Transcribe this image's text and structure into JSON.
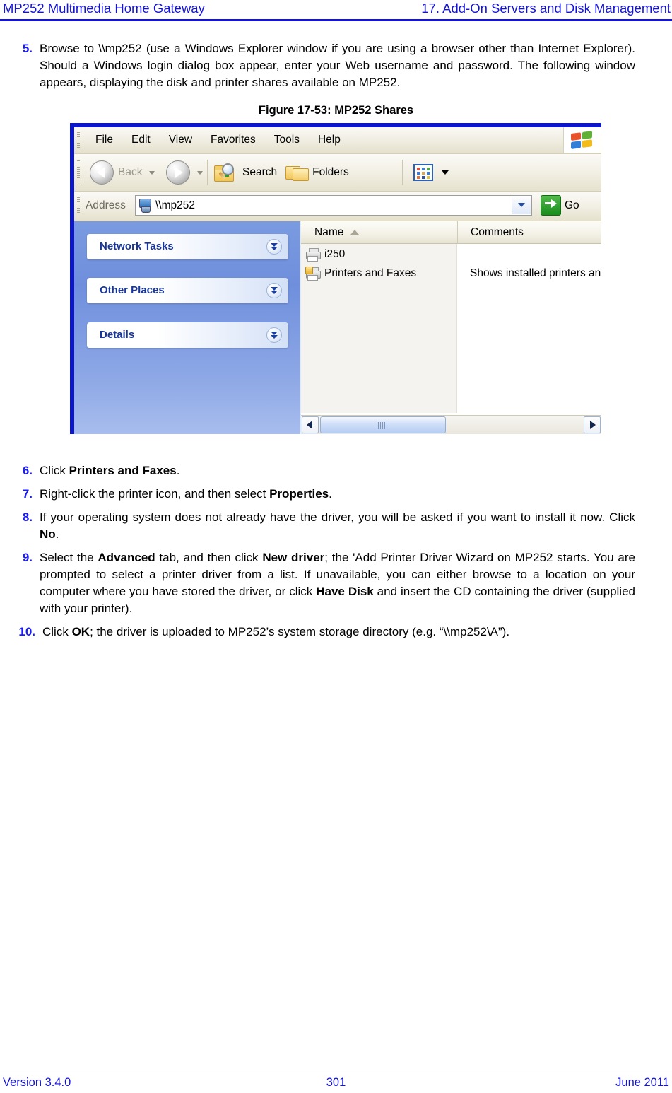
{
  "header": {
    "left": "MP252 Multimedia Home Gateway",
    "right": "17. Add-On Servers and Disk Management"
  },
  "steps": {
    "step5": {
      "number": "5.",
      "text": "Browse to \\\\mp252 (use a Windows Explorer window if you are using a browser other than Internet Explorer). Should a Windows login dialog box appear, enter your Web username and password. The following window appears, displaying the disk and printer shares available on MP252."
    },
    "step6": {
      "number": "6.",
      "pre": "Click ",
      "bold": "Printers and Faxes",
      "post": "."
    },
    "step7": {
      "number": "7.",
      "pre": "Right-click the printer icon, and then select ",
      "bold": "Properties",
      "post": "."
    },
    "step8": {
      "number": "8.",
      "pre": "If your operating system does not already have the driver, you will be asked if you want to install it now. Click ",
      "bold": "No",
      "post": "."
    },
    "step9": {
      "number": "9.",
      "p1": "Select the ",
      "b1": "Advanced",
      "p2": " tab, and then click ",
      "b2": "New driver",
      "p3": "; the 'Add Printer Driver Wizard on MP252 starts. You are prompted to select a printer driver from a list. If unavailable, you can either browse to a location on your computer where you have stored the driver, or click ",
      "b3": "Have Disk",
      "p4": " and insert the CD containing the driver (supplied with your printer)."
    },
    "step10": {
      "number": "10.",
      "pre": "Click ",
      "bold": "OK",
      "post": "; the driver is uploaded to MP252’s system storage directory (e.g. “\\\\mp252\\A”)."
    }
  },
  "figure": {
    "caption": "Figure 17-53: MP252 Shares",
    "window": {
      "menu": [
        {
          "label": "File",
          "name": "menu-file"
        },
        {
          "label": "Edit",
          "name": "menu-edit"
        },
        {
          "label": "View",
          "name": "menu-view"
        },
        {
          "label": "Favorites",
          "name": "menu-favorites"
        },
        {
          "label": "Tools",
          "name": "menu-tools"
        },
        {
          "label": "Help",
          "name": "menu-help"
        }
      ],
      "toolbar": {
        "back": "Back",
        "search": "Search",
        "folders": "Folders"
      },
      "address": {
        "label": "Address",
        "value": "\\\\mp252",
        "go": "Go"
      },
      "task_pane": {
        "panels": [
          {
            "title": "Network Tasks"
          },
          {
            "title": "Other Places"
          },
          {
            "title": "Details"
          }
        ]
      },
      "list": {
        "columns": [
          "Name",
          "Comments"
        ],
        "sort_column": "Name",
        "sort_direction": "ascending",
        "rows": [
          {
            "name": "i250",
            "comment": ""
          },
          {
            "name": "Printers and Faxes",
            "comment": "Shows installed printers and fax printers"
          }
        ]
      }
    }
  },
  "footer": {
    "left": "Version 3.4.0",
    "center": "301",
    "right": "June 2011"
  },
  "colors": {
    "header_blue": "#1414d8",
    "step_number_blue": "#1a1aff",
    "window_border_blue": "#0b17c8",
    "task_pane_blue": "#7a9ae0",
    "panel_title_blue": "#17379c"
  }
}
